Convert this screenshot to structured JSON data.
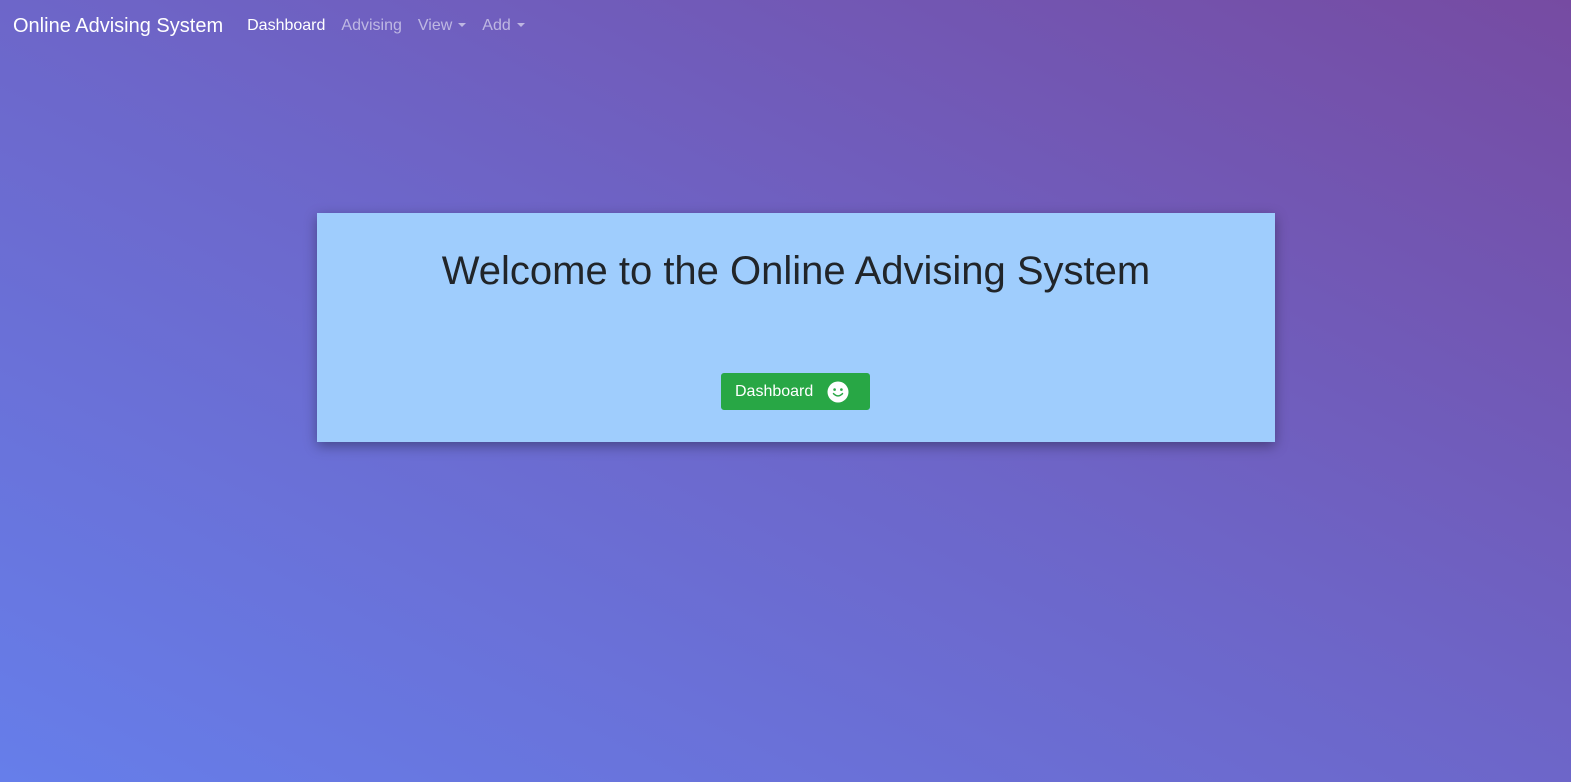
{
  "navbar": {
    "brand": "Online Advising System",
    "items": [
      {
        "label": "Dashboard",
        "active": true,
        "dropdown": false
      },
      {
        "label": "Advising",
        "active": false,
        "dropdown": false
      },
      {
        "label": "View",
        "active": false,
        "dropdown": true
      },
      {
        "label": "Add",
        "active": false,
        "dropdown": true
      }
    ]
  },
  "welcome": {
    "title": "Welcome to the Online Advising System",
    "button_label": "Dashboard",
    "button_icon": "smiley-icon"
  },
  "colors": {
    "card_background": "#9fcdfd",
    "button_background": "#28a745",
    "gradient_start": "#667eea",
    "gradient_end": "#764ba2"
  }
}
